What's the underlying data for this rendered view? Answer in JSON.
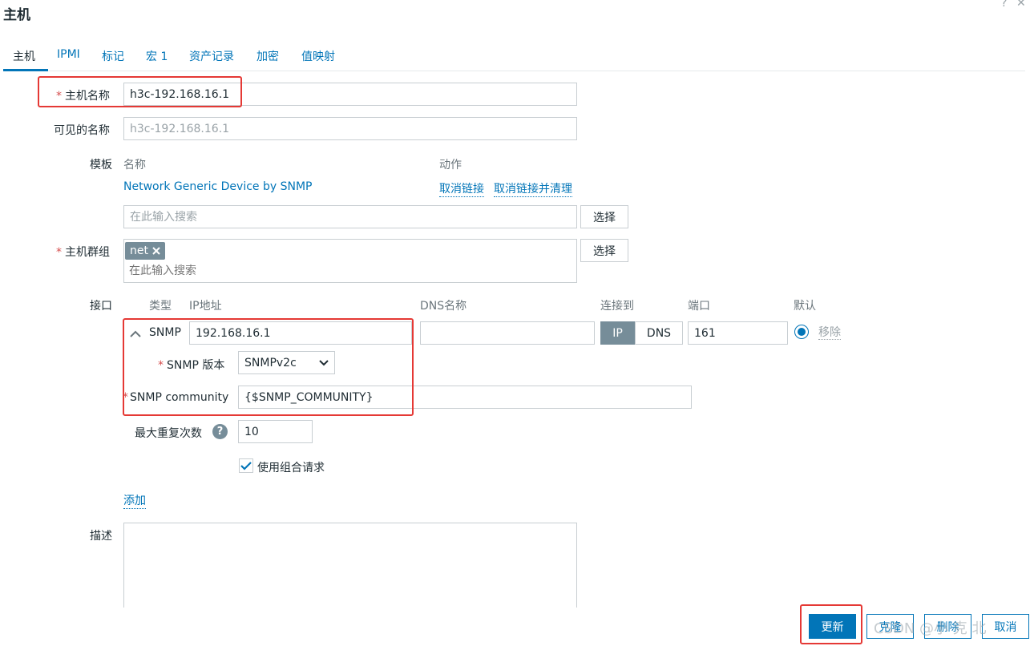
{
  "dialog": {
    "title": "主机",
    "help_glyph": "?",
    "close_glyph": "✕"
  },
  "tabs": [
    {
      "label": "主机"
    },
    {
      "label": "IPMI"
    },
    {
      "label": "标记"
    },
    {
      "label": "宏 1"
    },
    {
      "label": "资产记录"
    },
    {
      "label": "加密"
    },
    {
      "label": "值映射"
    }
  ],
  "host_name": {
    "label": "主机名称",
    "value": "h3c-192.168.16.1"
  },
  "visible_name": {
    "label": "可见的名称",
    "placeholder": "h3c-192.168.16.1"
  },
  "templates": {
    "label": "模板",
    "col_name": "名称",
    "col_action": "动作",
    "items": [
      {
        "name": "Network Generic Device by SNMP",
        "unlink": "取消链接",
        "unlink_clear": "取消链接并清理"
      }
    ],
    "search_placeholder": "在此输入搜索",
    "select_label": "选择"
  },
  "host_groups": {
    "label": "主机群组",
    "tags": [
      {
        "label": "net"
      }
    ],
    "search_placeholder": "在此输入搜索",
    "select_label": "选择"
  },
  "interfaces": {
    "label": "接口",
    "headers": {
      "type": "类型",
      "ip": "IP地址",
      "dns": "DNS名称",
      "connect": "连接到",
      "port": "端口",
      "default": "默认"
    },
    "snmp": {
      "type": "SNMP",
      "ip": "192.168.16.1",
      "dns": "",
      "connect_ip": "IP",
      "connect_dns": "DNS",
      "port": "161",
      "remove": "移除",
      "version_label": "SNMP 版本",
      "version": "SNMPv2c",
      "community_label": "SNMP community",
      "community": "{$SNMP_COMMUNITY}",
      "max_repetitions_label": "最大重复次数",
      "max_repetitions": "10",
      "bulk_label": "使用组合请求"
    },
    "add_label": "添加"
  },
  "description": {
    "label": "描述",
    "value": ""
  },
  "footer": {
    "update": "更新",
    "clone": "克隆",
    "delete": "删除",
    "cancel": "取消"
  },
  "watermark": "CSDN @小 克 北"
}
